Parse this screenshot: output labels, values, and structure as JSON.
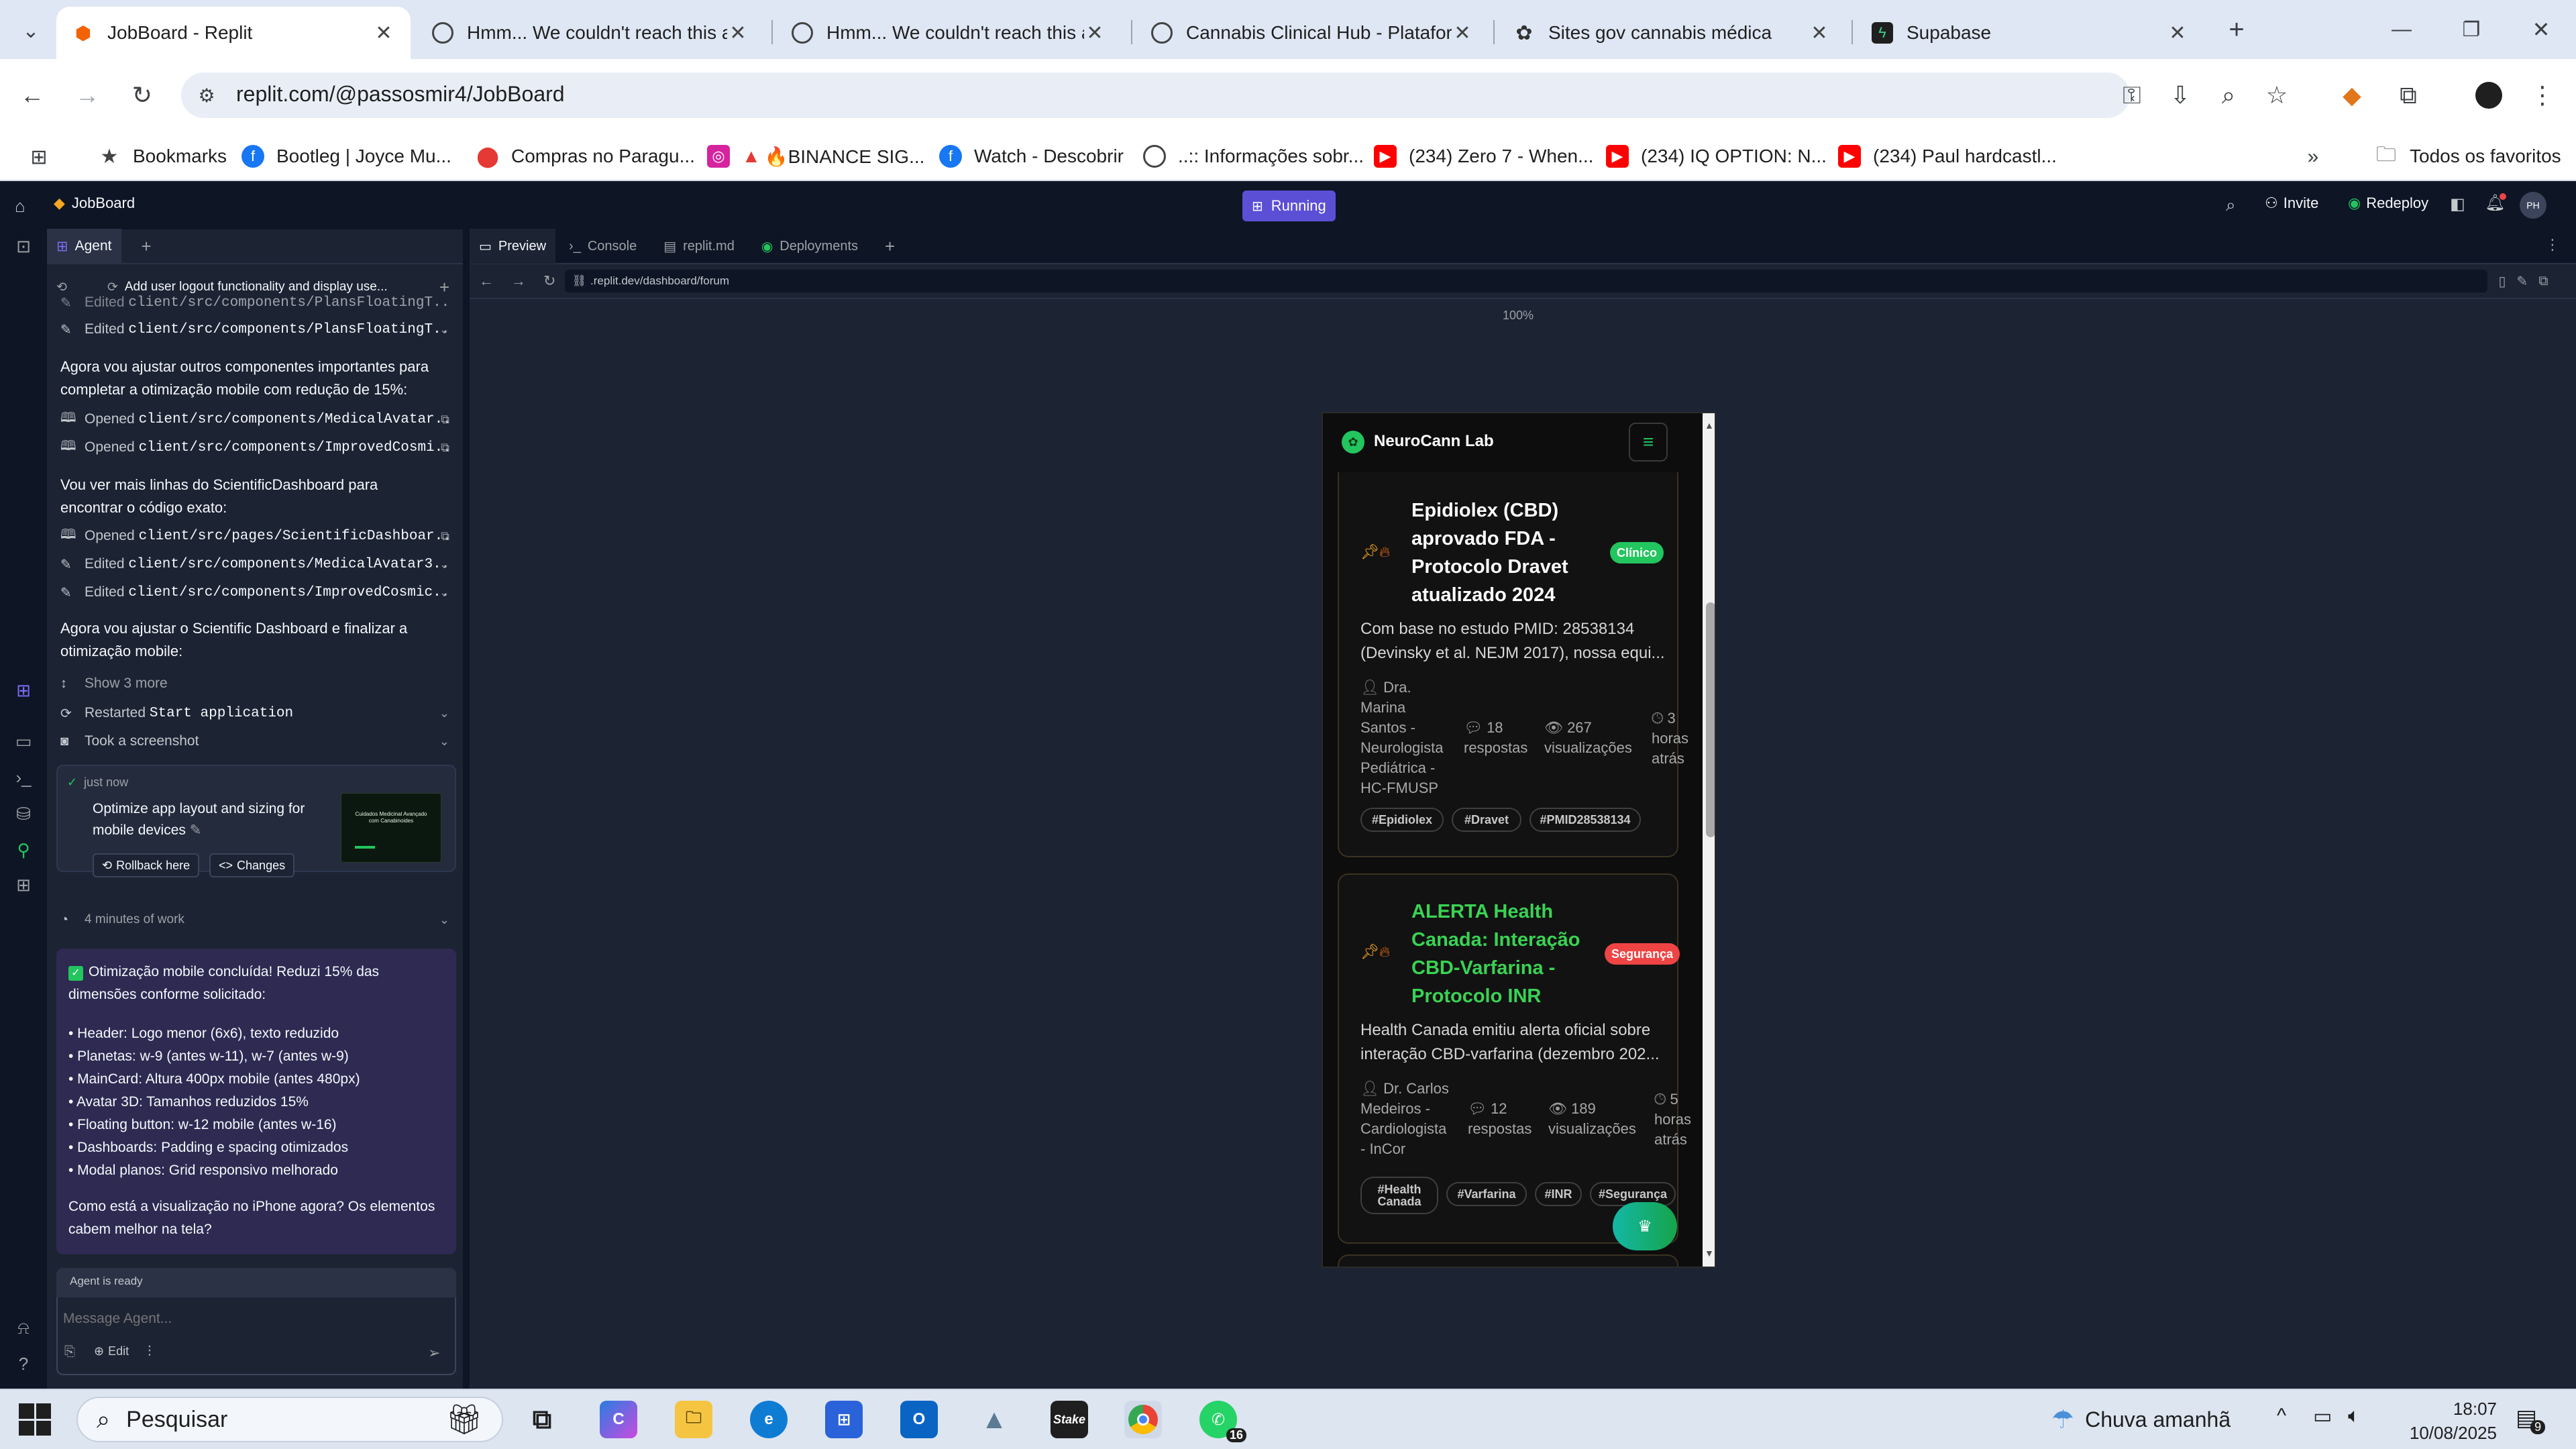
{
  "browser": {
    "tabs": [
      {
        "title": "JobBoard - Replit",
        "active": true
      },
      {
        "title": "Hmm... We couldn't reach this a",
        "active": false
      },
      {
        "title": "Hmm... We couldn't reach this a",
        "active": false
      },
      {
        "title": "Cannabis Clinical Hub - Platafor",
        "active": false
      },
      {
        "title": "Sites gov cannabis médica",
        "active": false
      },
      {
        "title": "Supabase",
        "active": false
      }
    ],
    "url": "replit.com/@passosmir4/JobBoard",
    "bookmarks": [
      "Bookmarks",
      "Bootleg | Joyce Mu...",
      "Compras no Paragu...",
      "🔥BINANCE SIG...",
      "Watch - Descobrir",
      "..:: Informações sobr...",
      "(234) Zero 7 - When...",
      "(234) IQ OPTION: N...",
      "(234) Paul hardcastl..."
    ],
    "all_bookmarks": "Todos os favoritos"
  },
  "replit": {
    "repl_name": "JobBoard",
    "run_status": "Running",
    "invite": "Invite",
    "redeploy": "Redeploy",
    "avatar_initials": "PH",
    "agent_tab": "Agent",
    "workspace_tabs": [
      "Preview",
      "Console",
      "replit.md",
      "Deployments"
    ],
    "preview_url": ".replit.dev/dashboard/forum",
    "zoom": "100%"
  },
  "agent": {
    "thread_title": "Add user logout functionality and display use...",
    "items": [
      {
        "icon": "edit",
        "verb": "Edited",
        "path": "client/src/components/PlansFloatingT..."
      },
      {
        "icon": "edit",
        "verb": "Edited",
        "path": "client/src/components/PlansFloatingT..."
      },
      {
        "type": "text",
        "text": "Agora vou ajustar outros componentes importantes para completar a otimização mobile com redução de 15%:"
      },
      {
        "icon": "open",
        "verb": "Opened",
        "path": "client/src/components/MedicalAvatar..."
      },
      {
        "icon": "open",
        "verb": "Opened",
        "path": "client/src/components/ImprovedCosmi..."
      },
      {
        "type": "text",
        "text": "Vou ver mais linhas do ScientificDashboard para encontrar o código exato:"
      },
      {
        "icon": "open",
        "verb": "Opened",
        "path": "client/src/pages/ScientificDashboar..."
      },
      {
        "icon": "edit",
        "verb": "Edited",
        "path": "client/src/components/MedicalAvatar3..."
      },
      {
        "icon": "edit",
        "verb": "Edited",
        "path": "client/src/components/ImprovedCosmic..."
      },
      {
        "type": "text",
        "text": "Agora vou ajustar o Scientific Dashboard e finalizar a otimização mobile:"
      }
    ],
    "show_more": "Show 3 more",
    "restarted_label": "Restarted",
    "restarted_target": "Start application",
    "screenshot_label": "Took a screenshot",
    "checkpoint": {
      "time": "just now",
      "title": "Optimize app layout and sizing for mobile devices",
      "rollback": "Rollback here",
      "changes": "Changes",
      "thumb_text": "Cuidados Medicinal Avançado com Canabinoides"
    },
    "work_time": "4 minutes of work",
    "summary": {
      "heading": "Otimização mobile concluída! Reduzi 15% das dimensões conforme solicitado:",
      "bullets": [
        "• Header: Logo menor (6x6), texto reduzido",
        "• Planetas: w-9 (antes w-11), w-7 (antes w-9)",
        "• MainCard: Altura 400px mobile (antes 480px)",
        "• Avatar 3D: Tamanhos reduzidos 15%",
        "• Floating button: w-12 mobile (antes w-16)",
        "• Dashboards: Padding e spacing otimizados",
        "• Modal planos: Grid responsivo melhorado"
      ],
      "question": "Como está a visualização no iPhone agora? Os elementos cabem melhor na tela?"
    },
    "status": "Agent is ready",
    "input_placeholder": "Message Agent...",
    "edit_label": "Edit"
  },
  "mobile": {
    "brand": "NeuroCann Lab",
    "posts": [
      {
        "title": "Epidiolex (CBD) aprovado FDA - Protocolo Dravet atualizado 2024",
        "category": "Clínico",
        "excerpt": "Com base no estudo PMID: 28538134 (Devinsky et al. NEJM 2017), nossa equi...",
        "author": "Dra. Marina Santos - Neurologista Pediátrica - HC-FMUSP",
        "replies_count": "18",
        "replies_label": "respostas",
        "views_count": "267",
        "views_label": "visualizações",
        "time": "3 horas atrás",
        "tags": [
          "#Epidiolex",
          "#Dravet",
          "#PMID28538134"
        ]
      },
      {
        "title": "ALERTA Health Canada: Interação CBD-Varfarina - Protocolo INR",
        "category": "Segurança",
        "excerpt": "Health Canada emitiu alerta oficial sobre interação CBD-varfarina (dezembro 202...",
        "author": "Dr. Carlos Medeiros - Cardiologista - InCor",
        "replies_count": "12",
        "replies_label": "respostas",
        "views_count": "189",
        "views_label": "visualizações",
        "time": "5 horas atrás",
        "tags": [
          "#Health Canada",
          "#Varfarina",
          "#INR",
          "#Segurança"
        ]
      }
    ]
  },
  "taskbar": {
    "search_placeholder": "Pesquisar",
    "weather": "Chuva amanhã",
    "time": "18:07",
    "date": "10/08/2025",
    "whatsapp_badge": "16",
    "notif_badge": "9"
  },
  "colors": {
    "replit_bg": "#0e1525",
    "panel_bg": "#1c2333",
    "running": "#5b4fd6",
    "green_brand": "#22c55e",
    "danger": "#ef4444",
    "alert_title": "#39d353"
  }
}
